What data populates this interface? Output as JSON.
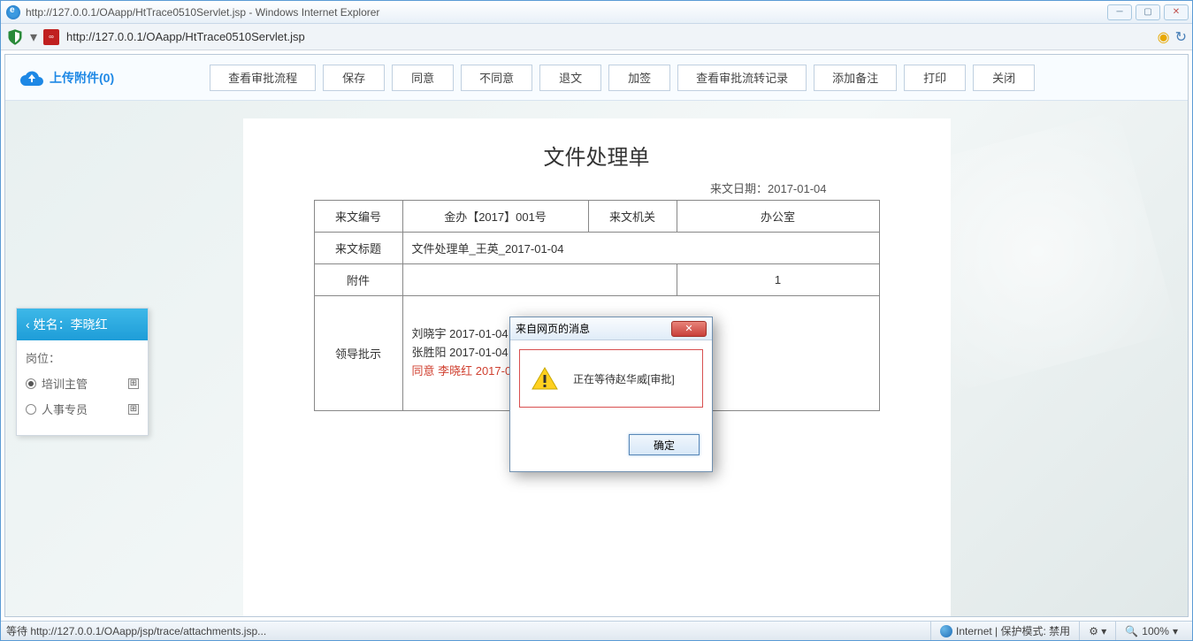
{
  "window": {
    "title": "http://127.0.0.1/OAapp/HtTrace0510Servlet.jsp - Windows Internet Explorer",
    "url": "http://127.0.0.1/OAapp/HtTrace0510Servlet.jsp"
  },
  "toolbar": {
    "upload_label": "上传附件(0)",
    "buttons": {
      "view_process": "查看审批流程",
      "save": "保存",
      "agree": "同意",
      "disagree": "不同意",
      "return": "退文",
      "cosign": "加签",
      "view_history": "查看审批流转记录",
      "add_note": "添加备注",
      "print": "打印",
      "close": "关闭"
    }
  },
  "document": {
    "title": "文件处理单",
    "date_label": "来文日期：2017-01-04",
    "fields": {
      "doc_no_label": "来文编号",
      "doc_no": "金办【2017】001号",
      "org_label": "来文机关",
      "org": "办公室",
      "subject_label": "来文标题",
      "subject": "文件处理单_王英_2017-01-04",
      "attach_label": "附件",
      "attach_count": "1",
      "approval_label": "领导批示",
      "approval_lines": {
        "l1": "刘晓宇 2017-01-04",
        "l2": "张胜阳 2017-01-04",
        "l3": "同意 李晓红  2017-0"
      }
    }
  },
  "sidebar": {
    "name_label": "姓名：李晓红",
    "position_label": "岗位：",
    "roles": {
      "r1": "培训主管",
      "r2": "人事专员"
    }
  },
  "dialog": {
    "title": "来自网页的消息",
    "message": "正在等待赵华威[审批]",
    "ok": "确定"
  },
  "statusbar": {
    "left": "等待 http://127.0.0.1/OAapp/jsp/trace/attachments.jsp...",
    "net": "Internet | 保护模式: 禁用",
    "zoom": "100%"
  }
}
